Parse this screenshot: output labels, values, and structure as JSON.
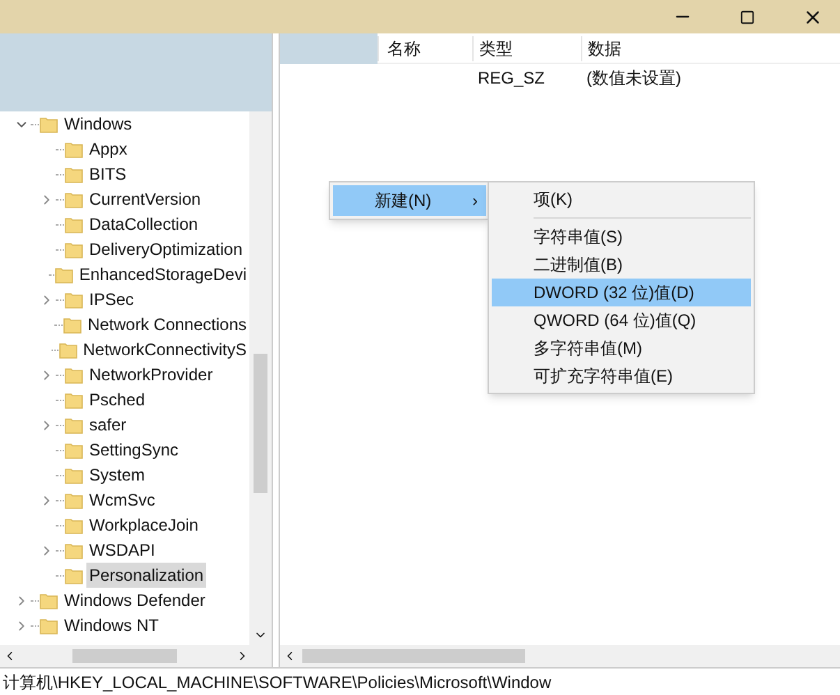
{
  "list_header": {
    "columns": [
      "名称",
      "类型",
      "数据"
    ]
  },
  "values": [
    {
      "type": "REG_SZ",
      "data": "(数值未设置)"
    }
  ],
  "tree": [
    {
      "label": "Windows",
      "has_children": true,
      "expanded": true,
      "selected": false,
      "children": [
        {
          "label": "Appx",
          "has_children": false,
          "selected": false
        },
        {
          "label": "BITS",
          "has_children": false,
          "selected": false
        },
        {
          "label": "CurrentVersion",
          "has_children": true,
          "expanded": false,
          "selected": false
        },
        {
          "label": "DataCollection",
          "has_children": false,
          "selected": false
        },
        {
          "label": "DeliveryOptimization",
          "has_children": false,
          "selected": false
        },
        {
          "label": "EnhancedStorageDevi",
          "has_children": false,
          "selected": false
        },
        {
          "label": "IPSec",
          "has_children": true,
          "expanded": false,
          "selected": false
        },
        {
          "label": "Network Connections",
          "has_children": false,
          "selected": false
        },
        {
          "label": "NetworkConnectivityS",
          "has_children": false,
          "selected": false
        },
        {
          "label": "NetworkProvider",
          "has_children": true,
          "expanded": false,
          "selected": false
        },
        {
          "label": "Psched",
          "has_children": false,
          "selected": false
        },
        {
          "label": "safer",
          "has_children": true,
          "expanded": false,
          "selected": false
        },
        {
          "label": "SettingSync",
          "has_children": false,
          "selected": false
        },
        {
          "label": "System",
          "has_children": false,
          "selected": false
        },
        {
          "label": "WcmSvc",
          "has_children": true,
          "expanded": false,
          "selected": false
        },
        {
          "label": "WorkplaceJoin",
          "has_children": false,
          "selected": false
        },
        {
          "label": "WSDAPI",
          "has_children": true,
          "expanded": false,
          "selected": false
        },
        {
          "label": "Personalization",
          "has_children": false,
          "selected": true
        }
      ]
    },
    {
      "label": "Windows Defender",
      "has_children": true,
      "expanded": false,
      "selected": false
    },
    {
      "label": "Windows NT",
      "has_children": true,
      "expanded": false,
      "selected": false
    }
  ],
  "context_menu": {
    "label": "新建(N)",
    "arrow": "›",
    "selected": true
  },
  "submenu": [
    {
      "kind": "item",
      "label": "项(K)",
      "selected": false
    },
    {
      "kind": "separator"
    },
    {
      "kind": "item",
      "label": "字符串值(S)",
      "selected": false
    },
    {
      "kind": "item",
      "label": "二进制值(B)",
      "selected": false
    },
    {
      "kind": "item",
      "label": "DWORD (32 位)值(D)",
      "selected": true
    },
    {
      "kind": "item",
      "label": "QWORD (64 位)值(Q)",
      "selected": false
    },
    {
      "kind": "item",
      "label": "多字符串值(M)",
      "selected": false
    },
    {
      "kind": "item",
      "label": "可扩充字符串值(E)",
      "selected": false
    }
  ],
  "status_bar": {
    "path": "计算机\\HKEY_LOCAL_MACHINE\\SOFTWARE\\Policies\\Microsoft\\Window"
  }
}
